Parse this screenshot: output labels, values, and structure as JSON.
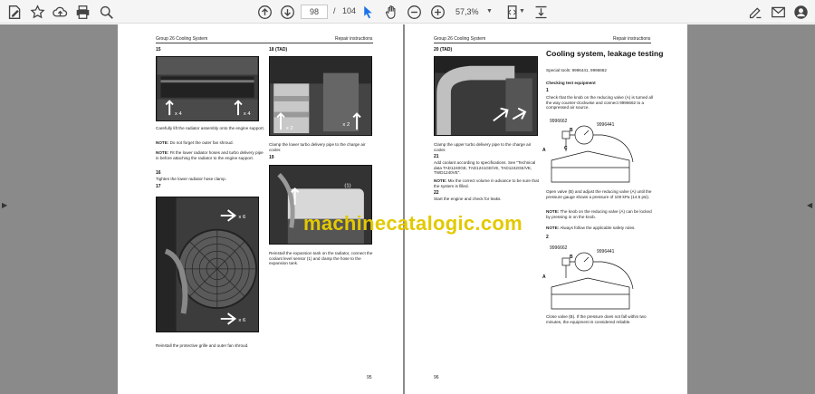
{
  "toolbar": {
    "page_current": "98",
    "page_sep": "/",
    "page_total": "104",
    "zoom": "57,3%"
  },
  "left_page": {
    "header_left": "Group 26 Cooling System",
    "header_right": "Repair instructions",
    "step15": "15",
    "step15_text1": "Carefully lift the radiator assembly onto the engine support.",
    "note_label": "NOTE:",
    "step15_note1": "Do not forget the outer fan shroud.",
    "step15_note2": "Fit the lower radiator hoses and turbo delivery pipe in before attaching the radiator to the engine support.",
    "step16": "16",
    "step16_text": "Tighten the lower radiator hose clamp.",
    "step17": "17",
    "step17_text": "Reinstall the protective grille and outer fan shroud.",
    "step18_title": "18 (TAD)",
    "step18_text": "Clamp the lower turbo delivery pipe to the charge air cooler.",
    "step19": "19",
    "step19_text": "Reinstall the expansion tank on the radiator, connect the coolant level sensor (1) and clamp the hose to the expansion tank.",
    "photo_label_x4a": "x 4",
    "photo_label_x4b": "x 4",
    "photo_label_x2a": "x 2",
    "photo_label_x2b": "x 2",
    "photo_label_x6a": "x 6",
    "photo_label_x6b": "x 6",
    "photo_label_1": "(1)",
    "page_number": "95"
  },
  "right_page": {
    "header_left": "Group 26 Cooling System",
    "header_right": "Repair instructions",
    "step20_title": "20 (TAD)",
    "step20_text": "Clamp the upper turbo delivery pipe to the charge air cooler.",
    "step21": "21",
    "step21_text": "Add coolant according to specifications. See \"Technical data TAD1240GE, TAD1241GE/VE, TAD1242GE/VE, TWD1240VE\".",
    "note_label": "NOTE:",
    "step21_note": "Mix the correct volume in advance to be sure that the system is filled.",
    "step22": "22",
    "step22_text": "Start the engine and check for leaks.",
    "section_title": "Cooling system, leakage testing",
    "special_tools": "Special tools: 9996441, 9996662",
    "checking_heading": "Checking test equipment",
    "step1": "1",
    "step1_text": "Check that the knob on the reducing valve (A) is turned all the way counter-clockwise and connect 9996662 to a compressed air source.",
    "tool_a": "9996662",
    "tool_b": "9996441",
    "label_a": "A",
    "label_b": "B",
    "label_c": "C",
    "step1_text2": "Open valve (B) and adjust the reducing valve (A) until the pressure gauge shows a pressure of 100 kPa (14.5 psi).",
    "step1_note1": "The knob on the reducing valve (A) can be locked by pressing in on the knob.",
    "step1_note2": "Always follow the applicable safety rules.",
    "step2": "2",
    "step2_text": "Close valve (B). If the pressure does not fall within two minutes, the equipment is considered reliable.",
    "page_number": "96"
  },
  "watermark": "machinecatalogic.com",
  "colors": {
    "watermark": "#e3c900",
    "canvas": "#8a8a8a",
    "toolbar": "#f5f5f5",
    "active_tool": "#1a73e8"
  }
}
